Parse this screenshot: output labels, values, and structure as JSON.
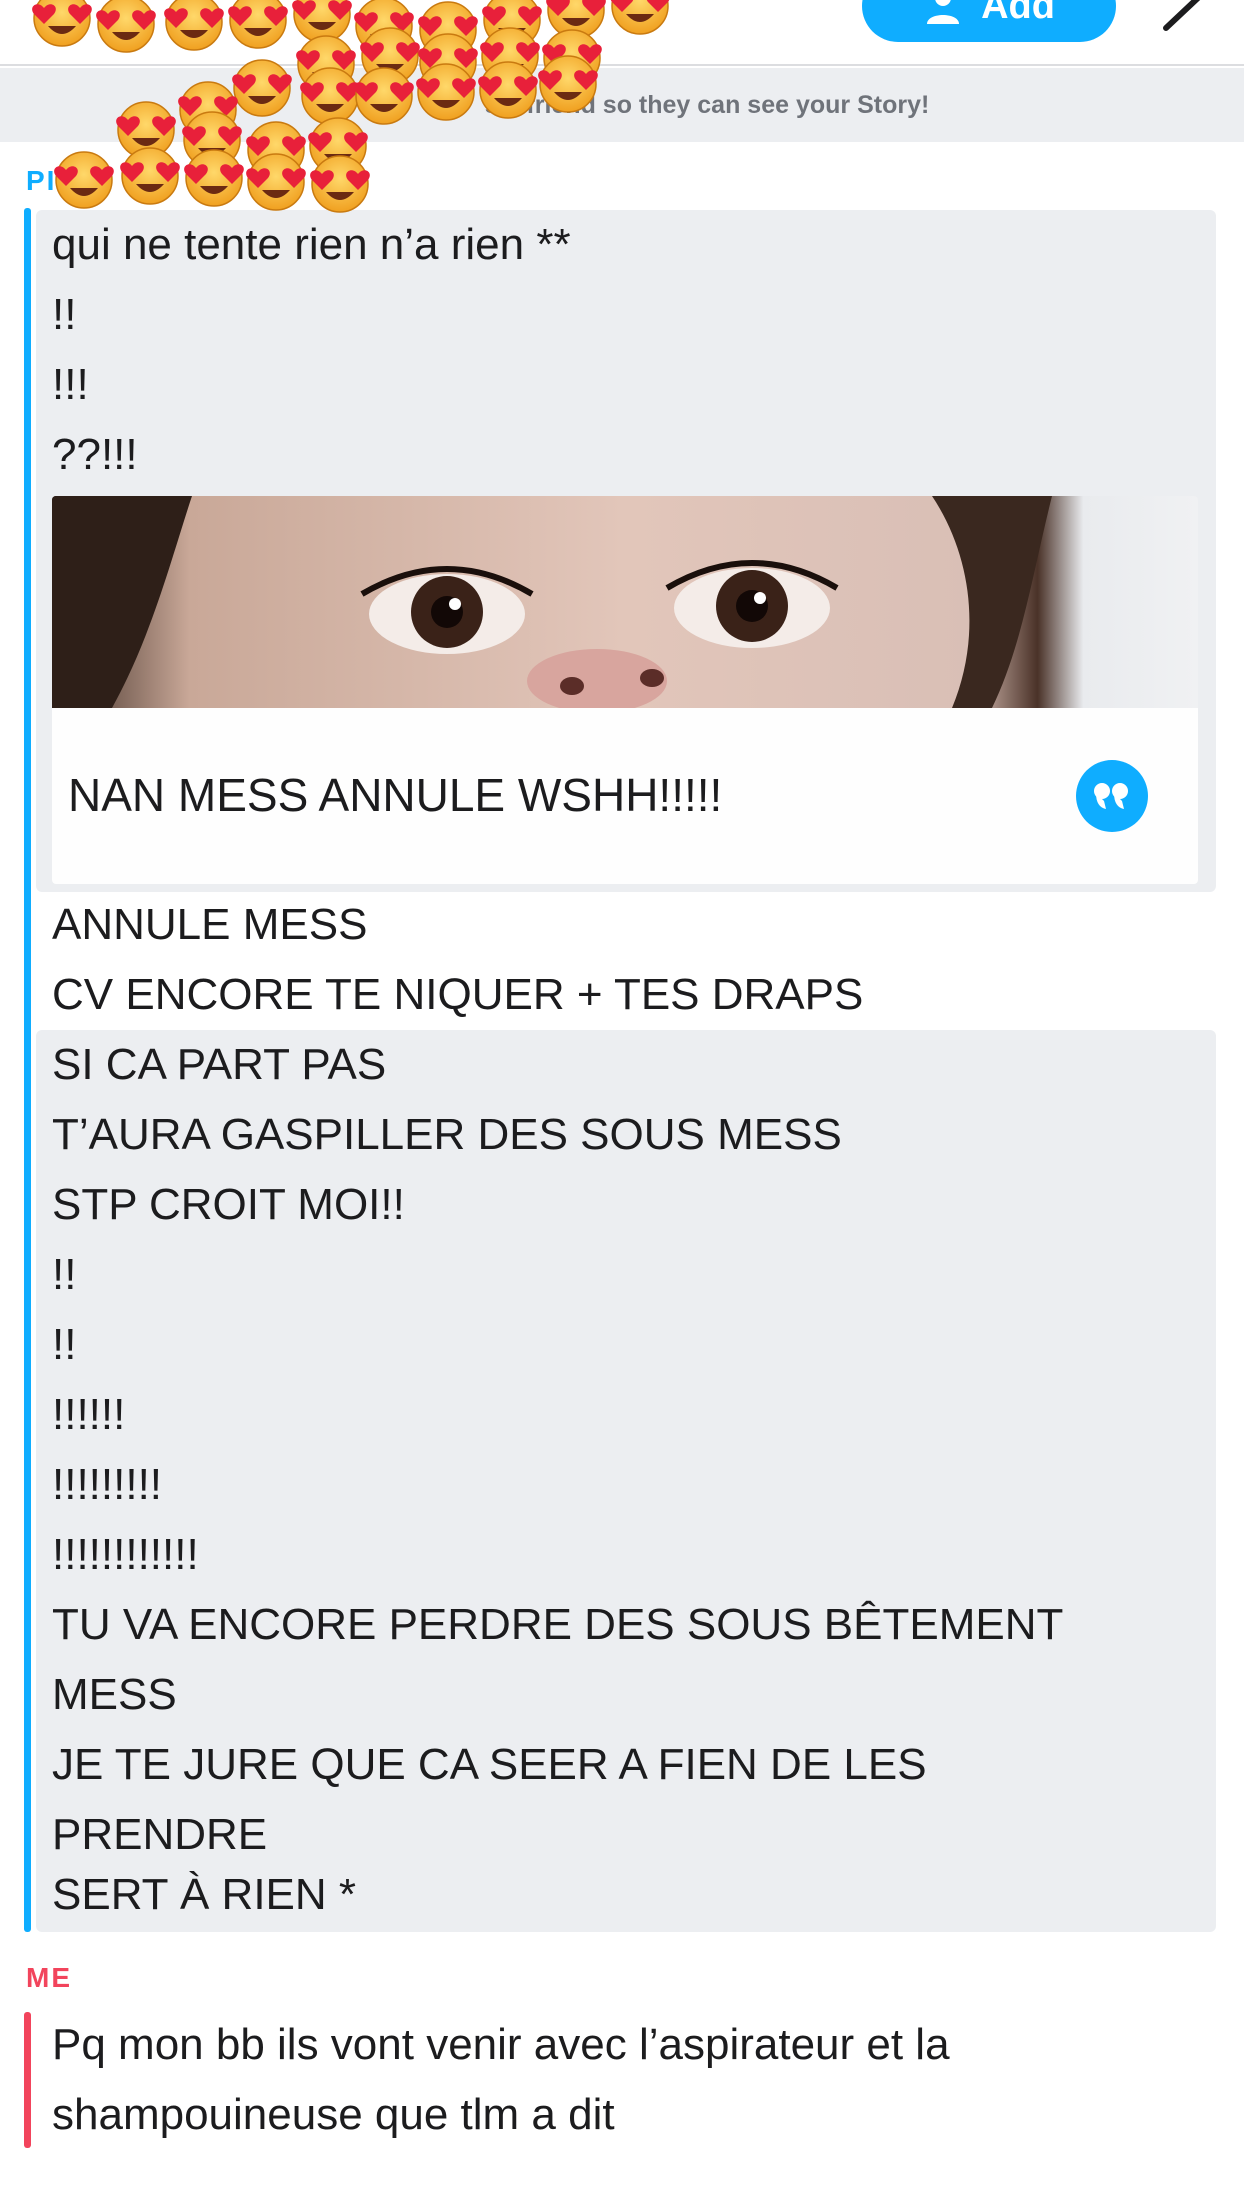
{
  "header": {
    "add_label": "Add"
  },
  "banner": {
    "text": "Add as a friend so they can see your Story!",
    "visible_text": "s a friend so they can see your Story!"
  },
  "partner": {
    "label": "PI"
  },
  "me": {
    "label": "ME"
  },
  "messages_top": [
    "qui ne tente rien n’a rien **",
    "!!",
    "!!!",
    "??!!!"
  ],
  "quoted": {
    "caption": "NAN MESS ANNULE WSHH!!!!!",
    "quote_icon": "quote-icon"
  },
  "messages_middle": [
    "ANNULE MESS",
    "CV ENCORE TE NIQUER + TES DRAPS"
  ],
  "messages_bottom": [
    "SI CA PART PAS",
    "T’AURA GASPILLER DES SOUS MESS",
    "STP CROIT MOI!!",
    "!!",
    "!!",
    "!!!!!!",
    "!!!!!!!!!",
    "!!!!!!!!!!!!",
    "TU VA ENCORE PERDRE DES SOUS BÊTEMENT",
    "MESS",
    "JE TE JURE QUE CA SEER A FIEN DE LES",
    "PRENDRE",
    "SERT À RIEN *"
  ],
  "messages_me": [
    "Pq mon bb ils vont venir avec l’aspirateur et la",
    "shampouineuse que tlm a dit"
  ],
  "colors": {
    "partner_accent": "#0fadff",
    "me_accent": "#f2445c",
    "bubble_grey": "#eceef1"
  }
}
